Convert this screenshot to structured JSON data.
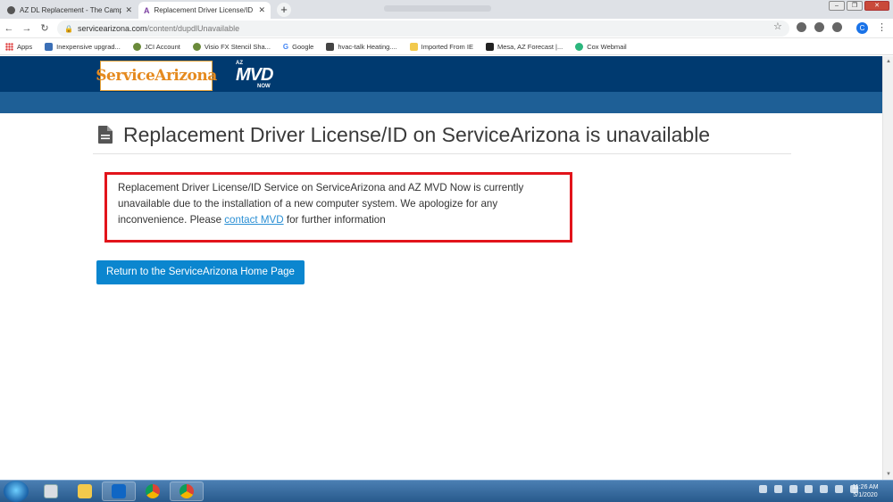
{
  "browser": {
    "tabs": [
      {
        "title": "AZ DL Replacement - The Camp",
        "active": false
      },
      {
        "title": "Replacement Driver License/ID o",
        "active": true
      }
    ],
    "new_tab": "+",
    "url_domain": "servicearizona.com",
    "url_path": "/content/dupdlUnavailable",
    "profile_initial": "C",
    "bookmarks": [
      {
        "label": "Apps",
        "icon": "apps-icon"
      },
      {
        "label": "Inexpensive upgrad...",
        "icon": "link-icon"
      },
      {
        "label": "JCI Account",
        "icon": "globe-icon"
      },
      {
        "label": "Visio FX Stencil Sha...",
        "icon": "globe-icon"
      },
      {
        "label": "Google",
        "icon": "google-icon"
      },
      {
        "label": "hvac-talk Heating....",
        "icon": "site-icon"
      },
      {
        "label": "Imported From IE",
        "icon": "folder-icon"
      },
      {
        "label": "Mesa, AZ Forecast |...",
        "icon": "site-icon"
      },
      {
        "label": "Cox Webmail",
        "icon": "cox-icon"
      }
    ]
  },
  "page": {
    "logo_text": "ServiceArizona",
    "mvd_logo": {
      "az": "AZ",
      "mvd": "MVD",
      "now": "NOW"
    },
    "heading": "Replacement Driver License/ID on ServiceArizona is unavailable",
    "notice_text": "Replacement Driver License/ID Service on ServiceArizona and AZ MVD Now is currently unavailable due to the installation of a new computer system. We apologize for any inconvenience. Please ",
    "notice_link": "contact MVD",
    "notice_text_end": " for further information",
    "button_label": "Return to the ServiceArizona Home Page"
  },
  "taskbar": {
    "time": "11:26 AM",
    "date": "5/1/2020"
  },
  "colors": {
    "header_blue": "#003a70",
    "subbar_blue": "#1e5f96",
    "notice_border": "#e2141b",
    "button_blue": "#0b86cf",
    "link_blue": "#2a8fd4"
  }
}
